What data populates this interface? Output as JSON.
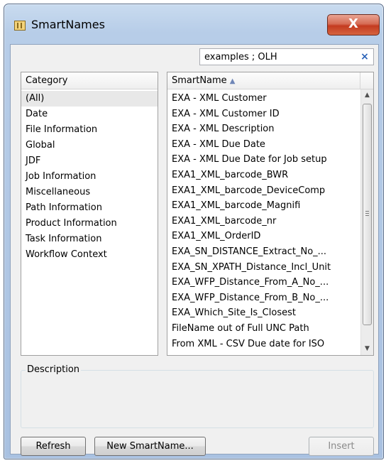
{
  "window": {
    "title": "SmartNames",
    "close_label": "X"
  },
  "search": {
    "value": "examples ; OLH",
    "clear_label": "×"
  },
  "category": {
    "header": "Category",
    "items": [
      "(All)",
      "Date",
      "File Information",
      "Global",
      "JDF",
      "Job Information",
      "Miscellaneous",
      "Path Information",
      "Product Information",
      "Task Information",
      "Workflow Context"
    ],
    "selected": "(All)"
  },
  "smartnames": {
    "header": "SmartName",
    "items": [
      "EXA - XML Customer",
      "EXA - XML Customer ID",
      "EXA - XML Description",
      "EXA - XML Due Date",
      "EXA - XML Due Date for Job setup",
      "EXA1_XML_barcode_BWR",
      "EXA1_XML_barcode_DeviceComp",
      "EXA1_XML_barcode_Magnifi",
      "EXA1_XML_barcode_nr",
      "EXA1_XML_OrderID",
      "EXA_SN_DISTANCE_Extract_No_...",
      "EXA_SN_XPATH_Distance_Incl_Unit",
      "EXA_WFP_Distance_From_A_No_...",
      "EXA_WFP_Distance_From_B_No_...",
      "EXA_Which_Site_Is_Closest",
      "FileName out of Full UNC Path",
      "From XML - CSV Due date for ISO"
    ]
  },
  "description": {
    "label": "Description"
  },
  "buttons": {
    "refresh": "Refresh",
    "new_smartname": "New SmartName...",
    "insert": "Insert"
  },
  "icons": {
    "app": "smartnames-app-icon",
    "sort": "sort-ascending-icon",
    "clear": "clear-search-icon"
  }
}
